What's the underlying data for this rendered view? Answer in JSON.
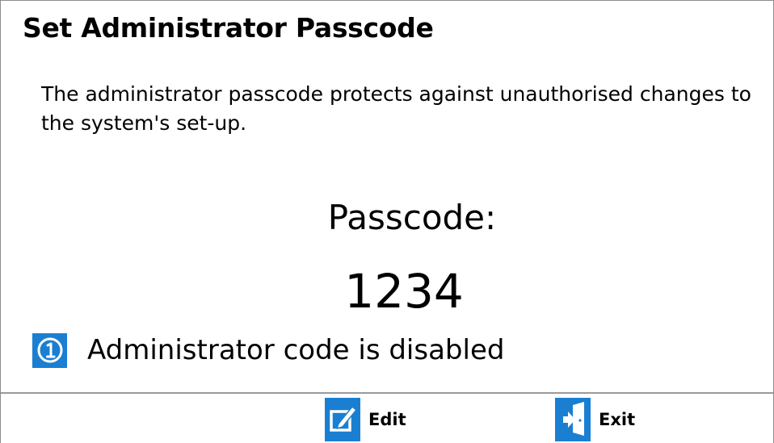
{
  "page": {
    "title": "Set Administrator Passcode",
    "description": "The administrator passcode protects against unauthorised changes to the system's set-up."
  },
  "passcode": {
    "label": "Passcode:",
    "value": "1234"
  },
  "status": {
    "icon": "info-circle-icon",
    "text": "Administrator code is disabled"
  },
  "footer": {
    "edit_label": "Edit",
    "edit_icon": "edit-pencil-icon",
    "exit_label": "Exit",
    "exit_icon": "exit-door-icon"
  },
  "colors": {
    "accent": "#1a7fd1",
    "text": "#000000",
    "background": "#ffffff",
    "divider": "#9a9a9a"
  }
}
